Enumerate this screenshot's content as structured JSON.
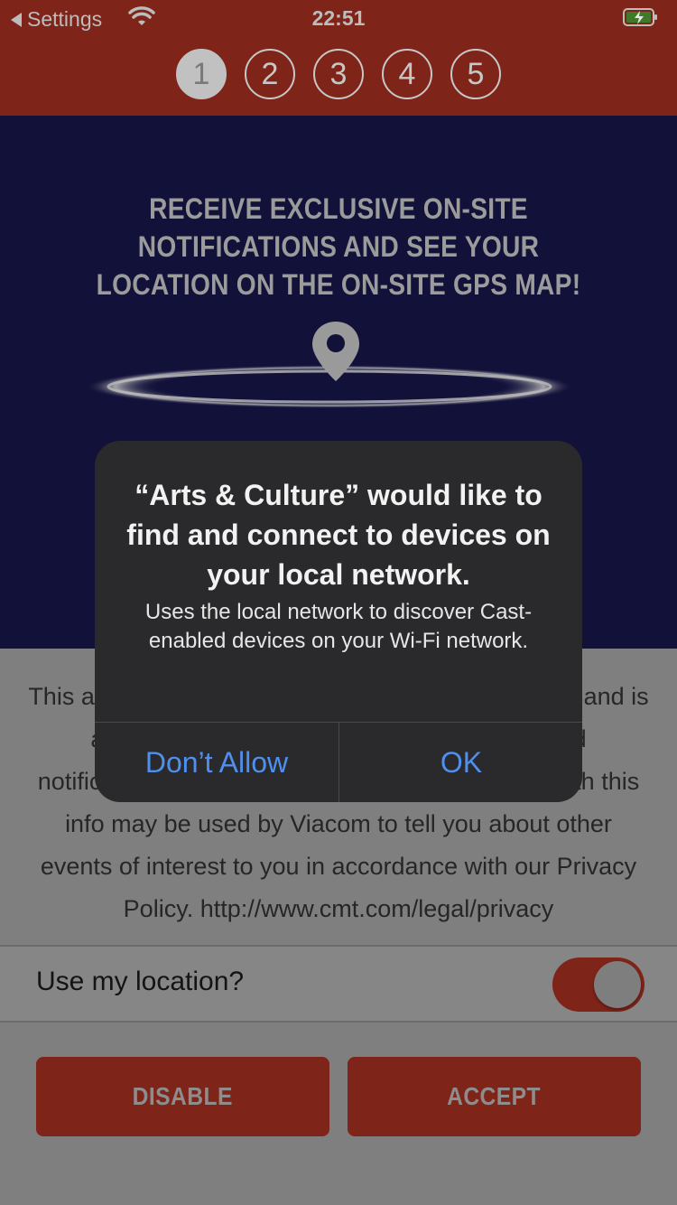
{
  "status_bar": {
    "back_label": "Settings",
    "time": "22:51",
    "icons": [
      "back-arrow-icon",
      "wifi-icon",
      "battery-charging-icon"
    ]
  },
  "steps": [
    "1",
    "2",
    "3",
    "4",
    "5"
  ],
  "active_step": "1",
  "hero": {
    "title": "RECEIVE EXCLUSIVE ON-SITE NOTIFICATIONS AND SEE YOUR LOCATION ON THE ON-SITE GPS MAP!",
    "icon": "location-pin-icon"
  },
  "policy_text": "This app uses your location to provide on-site GPS and is also used to send you relevant location-based notifications. Your location and data associated with this info may be used by Viacom to tell you about other events of interest to you in accordance with our Privacy Policy. http://www.cmt.com/legal/privacy",
  "location_toggle": {
    "label": "Use my location?",
    "on": true
  },
  "buttons": {
    "disable": "DISABLE",
    "accept": "ACCEPT"
  },
  "alert": {
    "title": "“Arts & Culture” would like to find and connect to devices on your local network.",
    "message": "Uses the local network to discover Cast-enabled devices on your Wi-Fi network.",
    "deny_label": "Don’t Allow",
    "ok_label": "OK"
  },
  "colors": {
    "header_red": "#7f2419",
    "hero_navy": "#12113a",
    "alert_bg": "#2a2a2c",
    "alert_button": "#4f8fee"
  }
}
